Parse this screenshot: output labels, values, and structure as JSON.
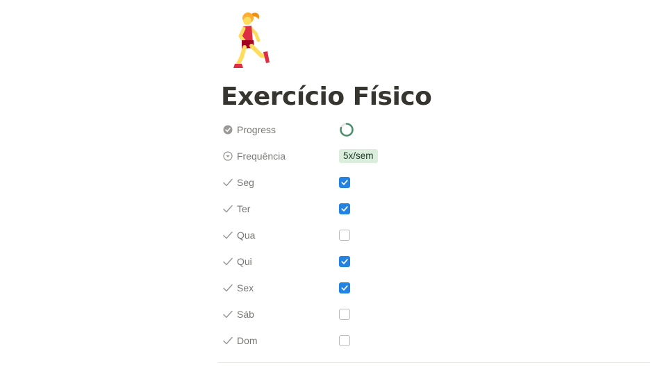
{
  "page": {
    "icon": "woman-running-emoji",
    "title": "Exercício Físico"
  },
  "properties": {
    "progress": {
      "label": "Progress",
      "icon": "formula-check-icon",
      "ring_color": "#4a8d6b",
      "value_fraction": 0.8
    },
    "frequencia": {
      "label": "Frequência",
      "icon": "select-arrow-icon",
      "value": "5x/sem",
      "tag_color": "#dbeddb"
    },
    "days": [
      {
        "key": "seg",
        "label": "Seg",
        "checked": true
      },
      {
        "key": "ter",
        "label": "Ter",
        "checked": true
      },
      {
        "key": "qua",
        "label": "Qua",
        "checked": false
      },
      {
        "key": "qui",
        "label": "Qui",
        "checked": true
      },
      {
        "key": "sex",
        "label": "Sex",
        "checked": true
      },
      {
        "key": "sab",
        "label": "Sáb",
        "checked": false
      },
      {
        "key": "dom",
        "label": "Dom",
        "checked": false
      }
    ],
    "checkbox_color": "#2383e2"
  }
}
